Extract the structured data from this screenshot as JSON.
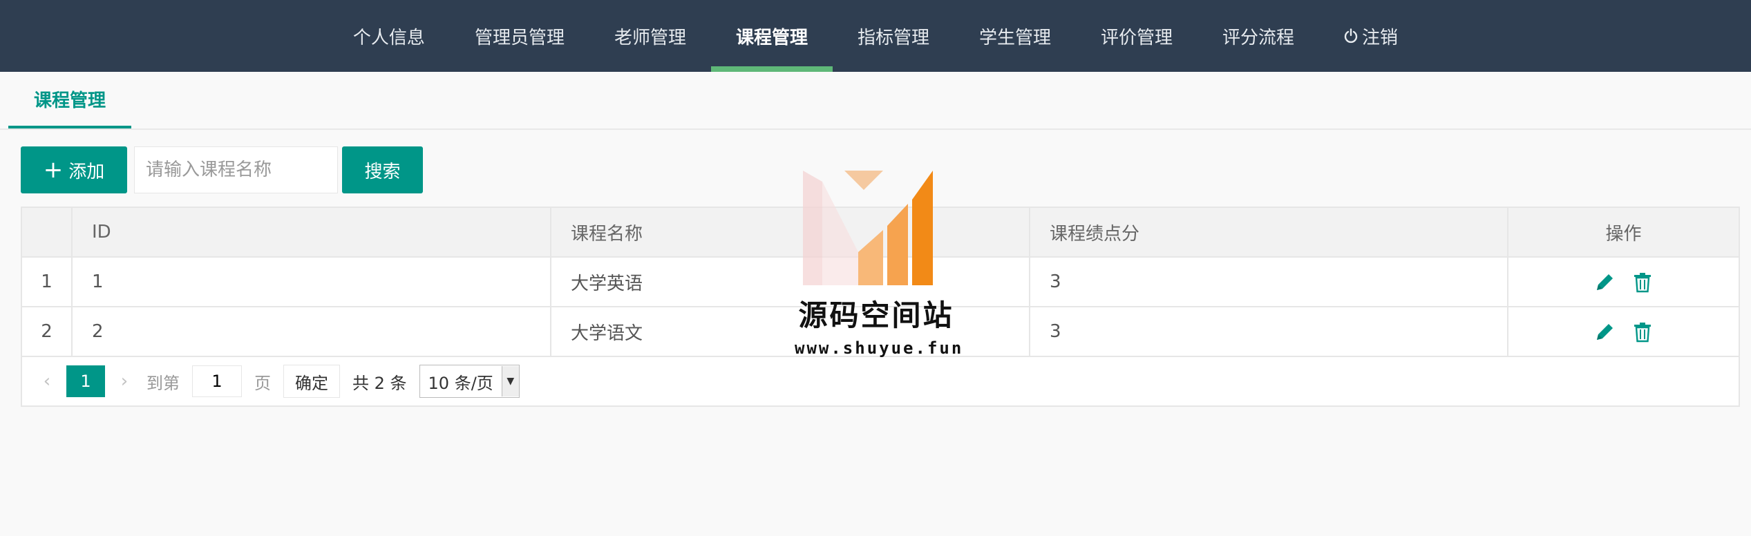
{
  "nav": {
    "items": [
      {
        "label": "个人信息"
      },
      {
        "label": "管理员管理"
      },
      {
        "label": "老师管理"
      },
      {
        "label": "课程管理"
      },
      {
        "label": "指标管理"
      },
      {
        "label": "学生管理"
      },
      {
        "label": "评价管理"
      },
      {
        "label": "评分流程"
      }
    ],
    "active_index": 3,
    "logout_label": "注销",
    "logout_icon": "power-icon"
  },
  "tab": {
    "label": "课程管理"
  },
  "toolbar": {
    "add_label": "添加",
    "search_placeholder": "请输入课程名称",
    "search_label": "搜索"
  },
  "table": {
    "columns": [
      "ID",
      "课程名称",
      "课程绩点分",
      "操作"
    ],
    "rows": [
      {
        "num": "1",
        "id": "1",
        "name": "大学英语",
        "credit": "3"
      },
      {
        "num": "2",
        "id": "2",
        "name": "大学语文",
        "credit": "3"
      }
    ],
    "row_actions": [
      "edit-icon",
      "trash-icon"
    ]
  },
  "pager": {
    "current": "1",
    "goto_label": "到第",
    "page_input": "1",
    "page_unit": "页",
    "confirm_label": "确定",
    "total_label": "共 2 条",
    "page_size": "10 条/页"
  },
  "watermark": {
    "title": "源码空间站",
    "url": "www.shuyue.fun"
  },
  "colors": {
    "header_bg": "#2f3e51",
    "accent": "#009688",
    "active_underline": "#5fb878"
  }
}
